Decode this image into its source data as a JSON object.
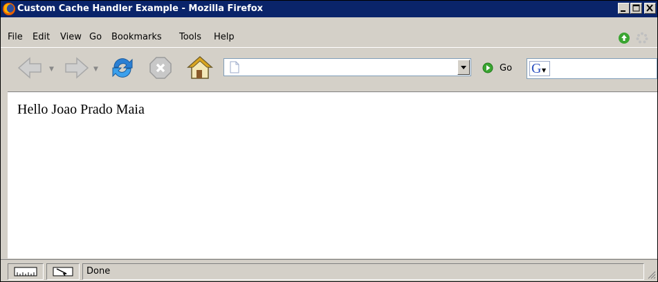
{
  "window": {
    "title": "Custom Cache Handler Example - Mozilla Firefox"
  },
  "menu": {
    "items": [
      {
        "label": "File"
      },
      {
        "label": "Edit"
      },
      {
        "label": "View"
      },
      {
        "label": "Go"
      },
      {
        "label": "Bookmarks"
      },
      {
        "label": "Tools"
      },
      {
        "label": "Help"
      }
    ]
  },
  "toolbar": {
    "url_value": "",
    "go_label": "Go",
    "search_value": ""
  },
  "page": {
    "text": "Hello Joao Prado Maia"
  },
  "status": {
    "text": "Done"
  },
  "colors": {
    "titlebar": "#0a246a",
    "chrome": "#d4d0c8",
    "go_green": "#3aa531"
  },
  "icons": [
    "firefox-logo-icon",
    "minimize-icon",
    "maximize-icon",
    "close-icon",
    "update-icon",
    "throbber-icon",
    "back-icon",
    "forward-icon",
    "reload-icon",
    "stop-icon",
    "home-icon",
    "page-icon",
    "go-icon",
    "google-icon"
  ]
}
